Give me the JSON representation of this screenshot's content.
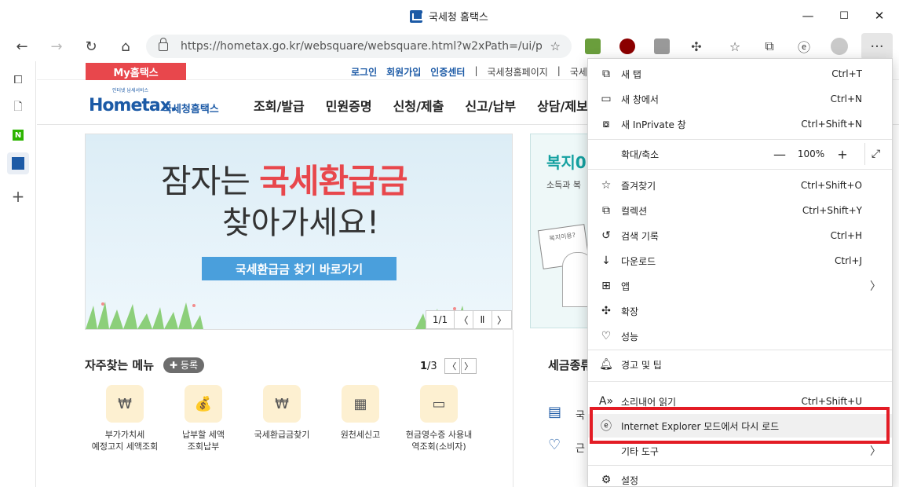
{
  "window": {
    "title": "국세청 홈택스",
    "min": "—",
    "max": "☐",
    "close": "✕"
  },
  "address": {
    "url": "https://hometax.go.kr/websquare/websquare.html?w2xPath=/ui/pp/ind..."
  },
  "toolbar": {
    "back": "←",
    "forward": "→",
    "refresh": "↻",
    "home": "⌂",
    "settings_more": "···"
  },
  "sidebar": {
    "add": "+",
    "naver": "N"
  },
  "site": {
    "my_tab": "My홈택스",
    "toplinks": [
      "로그인",
      "회원가입",
      "인증센터",
      "|",
      "국세청홈페이지",
      "|",
      "국세상담센터"
    ],
    "logo_brand": "Hometax.",
    "logo_kr": "국세청홈택스",
    "logo_tagline": "인터넷 납세서비스",
    "nav": [
      "조회/발급",
      "민원증명",
      "신청/제출",
      "신고/납부",
      "상담/제보"
    ],
    "banner": {
      "line1_pre": "잠자는 ",
      "line1_red": "국세환급금",
      "line2": "찾아가세요!",
      "cta": "국세환급금 찾기 바로가기",
      "pager_count": "1/1",
      "prev": "〈",
      "pause": "Ⅱ",
      "next": "〉"
    },
    "side_banner": {
      "title": "복지0",
      "subtitle": "소득과 복",
      "sign": "복지이용?"
    },
    "favorites": {
      "heading": "자주찾는 메뉴",
      "register": "✚ 등록",
      "page_cur": "1",
      "page_total": "/3",
      "prev": "〈",
      "next": "〉",
      "items": [
        {
          "l1": "부가가치세",
          "l2": "예정고지 세액조회"
        },
        {
          "l1": "납부할 세액",
          "l2": "조회납부"
        },
        {
          "l1": "국세환급금찾기",
          "l2": ""
        },
        {
          "l1": "원천세신고",
          "l2": ""
        },
        {
          "l1": "현금영수증 사용내",
          "l2": "역조회(소비자)"
        }
      ]
    },
    "tax": {
      "heading": "세금종류",
      "item1": "국",
      "item2": "근"
    }
  },
  "menu": {
    "new_tab": {
      "label": "새 탭",
      "shortcut": "Ctrl+T"
    },
    "new_window": {
      "label": "새 창에서",
      "shortcut": "Ctrl+N"
    },
    "inprivate": {
      "label": "새 InPrivate 창",
      "shortcut": "Ctrl+Shift+N"
    },
    "zoom": {
      "label": "확대/축소",
      "minus": "—",
      "value": "100%",
      "plus": "+",
      "fullscreen": "⤢"
    },
    "favorites": {
      "label": "즐겨찾기",
      "shortcut": "Ctrl+Shift+O"
    },
    "collections": {
      "label": "컬렉션",
      "shortcut": "Ctrl+Shift+Y"
    },
    "history": {
      "label": "검색 기록",
      "shortcut": "Ctrl+H"
    },
    "downloads": {
      "label": "다운로드",
      "shortcut": "Ctrl+J"
    },
    "apps": {
      "label": "앱",
      "chevron": "〉"
    },
    "extensions": {
      "label": "확장"
    },
    "performance": {
      "label": "성능"
    },
    "alerts": {
      "label": "경고 및 팁"
    },
    "read_aloud": {
      "label": "소리내어 읽기",
      "shortcut": "Ctrl+Shift+U"
    },
    "ie_mode": {
      "label": "Internet Explorer 모드에서 다시 로드"
    },
    "more_tools": {
      "label": "기타 도구",
      "chevron": "〉"
    },
    "settings": {
      "label": "설정"
    }
  },
  "colors": {
    "accent_red": "#e8474c",
    "brand_blue": "#1c5aa6",
    "highlight_box": "#e31c25",
    "cta_blue": "#4a9fdc"
  }
}
